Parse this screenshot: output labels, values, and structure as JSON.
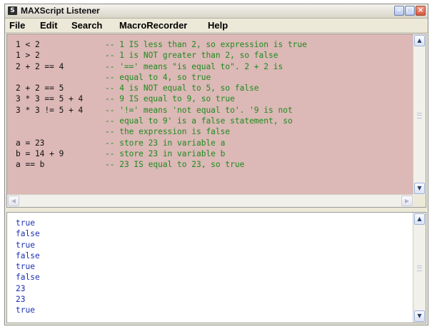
{
  "window": {
    "title": "MAXScript Listener",
    "app_icon": "S"
  },
  "menu": [
    "File",
    "Edit",
    "Search",
    "MacroRecorder",
    "Help"
  ],
  "macro_pane": {
    "lines": [
      {
        "expr": "1 < 2",
        "comment": "-- 1 IS less than 2, so expression is true"
      },
      {
        "expr": "1 > 2",
        "comment": "-- 1 is NOT greater than 2, so false"
      },
      {
        "expr": "2 + 2 == 4",
        "comment": "-- '==' means \"is equal to\". 2 + 2 is"
      },
      {
        "expr": "",
        "comment": "-- equal to 4, so true"
      },
      {
        "expr": "2 + 2 == 5",
        "comment": "-- 4 is NOT equal to 5, so false"
      },
      {
        "expr": "3 * 3 == 5 + 4",
        "comment": "-- 9 IS equal to 9, so true"
      },
      {
        "expr": "3 * 3 != 5 + 4",
        "comment": "-- '!=' means 'not equal to'. '9 is not"
      },
      {
        "expr": "",
        "comment": "-- equal to 9' is a false statement, so"
      },
      {
        "expr": "",
        "comment": "-- the expression is false"
      },
      {
        "expr": "a = 23",
        "comment": "-- store 23 in variable a"
      },
      {
        "expr": "b = 14 + 9",
        "comment": "-- store 23 in variable b"
      },
      {
        "expr": "a == b",
        "comment": "-- 23 IS equal to 23, so true"
      }
    ]
  },
  "output_pane": {
    "lines": [
      "true",
      "false",
      "true",
      "false",
      "true",
      "false",
      "23",
      "23",
      "true"
    ]
  },
  "colors": {
    "macro_bg": "#dcb8b6",
    "comment": "#1f8a1f",
    "output": "#1a2fb4"
  },
  "icons": {
    "minimize": "minimize-icon",
    "maximize": "maximize-icon",
    "close": "close-icon",
    "scroll_up": "arrow-up-icon",
    "scroll_down": "arrow-down-icon",
    "scroll_left": "arrow-left-icon",
    "scroll_right": "arrow-right-icon"
  }
}
